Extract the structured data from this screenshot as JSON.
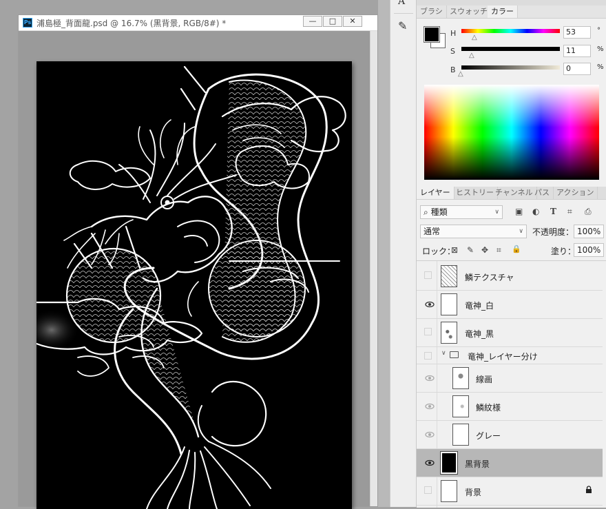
{
  "document": {
    "title": "浦島極_背面龍.psd @ 16.7% (黒背景, RGB/8#) *",
    "app_badge": "Ps",
    "window_buttons": [
      "—",
      "□",
      "✕"
    ]
  },
  "toolbar": {
    "tools": [
      "type-tool",
      "brush-tool"
    ],
    "tool_glyphs": [
      "A",
      "✎"
    ]
  },
  "color_panel": {
    "tabs": [
      "ブラシ",
      "スウォッチ",
      "カラー"
    ],
    "active_tab": "カラー",
    "foreground": "#000000",
    "background": "#ffffff",
    "sliders": [
      {
        "label": "H",
        "value": "53",
        "unit": "°",
        "fraction": 0.147
      },
      {
        "label": "S",
        "value": "11",
        "unit": "%",
        "fraction": 0.11
      },
      {
        "label": "B",
        "value": "0",
        "unit": "%",
        "fraction": 0.0
      }
    ]
  },
  "layers_panel": {
    "tabs": [
      "レイヤー",
      "ヒストリー",
      "チャンネル",
      "パス",
      "アクション"
    ],
    "active_tab": "レイヤー",
    "filter_label": "種類",
    "filter_icon": "⌕",
    "filter_icons": [
      "▣",
      "◐",
      "T",
      "⌗",
      "⎙"
    ],
    "blend_mode": "通常",
    "opacity_label": "不透明度：",
    "opacity_value": "100%",
    "lock_label": "ロック：",
    "lock_icons": [
      "⊠",
      "✎",
      "✥",
      "⌗",
      "🔒"
    ],
    "fill_label": "塗り：",
    "fill_value": "100%",
    "layers": [
      {
        "name": "鱗テクスチャ",
        "visible": false,
        "thumb": "pattern",
        "selected": false,
        "locked": false,
        "indent": false
      },
      {
        "name": "竜神_白",
        "visible": true,
        "thumb": "white",
        "selected": false,
        "locked": false,
        "indent": false
      },
      {
        "name": "竜神_黒",
        "visible": false,
        "thumb": "sketch",
        "selected": false,
        "locked": false,
        "indent": false
      },
      {
        "name": "竜神_レイヤー分け",
        "visible": false,
        "thumb": "folder",
        "selected": false,
        "locked": false,
        "indent": false,
        "group": true
      },
      {
        "name": "線画",
        "visible": true,
        "dim": true,
        "thumb": "sketch",
        "selected": false,
        "locked": false,
        "indent": true
      },
      {
        "name": "鱗紋様",
        "visible": true,
        "dim": true,
        "thumb": "sketch",
        "selected": false,
        "locked": false,
        "indent": true
      },
      {
        "name": "グレー",
        "visible": true,
        "dim": true,
        "thumb": "white",
        "selected": false,
        "locked": false,
        "indent": true
      },
      {
        "name": "黒背景",
        "visible": true,
        "thumb": "black",
        "selected": true,
        "locked": false,
        "indent": false
      },
      {
        "name": "背景",
        "visible": false,
        "thumb": "white",
        "selected": false,
        "locked": true,
        "indent": false
      }
    ]
  }
}
